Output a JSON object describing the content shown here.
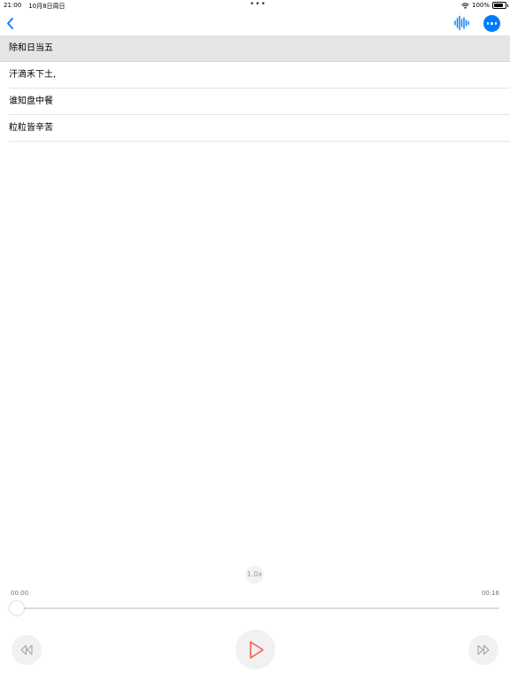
{
  "status_bar": {
    "time": "21:00",
    "date": "10月8日周日",
    "battery": "100%"
  },
  "toolbar": {
    "back_icon": "chevron-left-icon",
    "waveform_icon": "waveform-icon",
    "more_icon": "ellipsis-circle-icon",
    "accent_color": "#007aff"
  },
  "lyrics": {
    "lines": [
      {
        "text": "除和日当五",
        "active": true
      },
      {
        "text": "汗滴禾下土,",
        "active": false
      },
      {
        "text": "谁知盘中餐",
        "active": false
      },
      {
        "text": "粒粒皆辛苦",
        "active": false
      }
    ]
  },
  "player": {
    "speed": "1.0x",
    "current_time": "00:00",
    "total_time": "00:16",
    "progress": 0,
    "rewind_icon": "rewind-icon",
    "play_icon": "play-icon",
    "forward_icon": "fast-forward-icon",
    "play_color": "#ff5a4e"
  }
}
